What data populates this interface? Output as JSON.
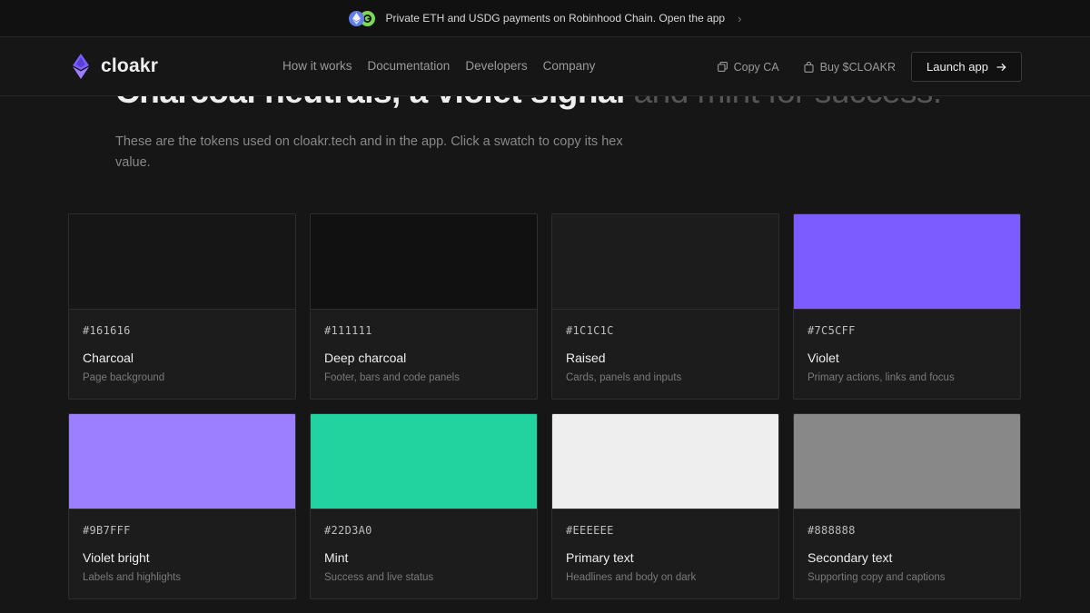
{
  "announcement": {
    "text": "Private ETH and USDG payments on Robinhood Chain. Open the app",
    "chevron": "›"
  },
  "header": {
    "logo_text": "cloakr",
    "nav": [
      "How it works",
      "Documentation",
      "Developers",
      "Company"
    ],
    "copy_ca": "Copy CA",
    "buy": "Buy $CLOAKR",
    "launch": "Launch app"
  },
  "hero": {
    "headline_strong": "Charcoal neutrals, a violet signal",
    "headline_muted": " and mint for success.",
    "subtitle": "These are the tokens used on cloakr.tech and in the app. Click a swatch to copy its hex value."
  },
  "swatches": [
    {
      "hex": "#161616",
      "name": "Charcoal",
      "desc": "Page background"
    },
    {
      "hex": "#111111",
      "name": "Deep charcoal",
      "desc": "Footer, bars and code panels"
    },
    {
      "hex": "#1C1C1C",
      "name": "Raised",
      "desc": "Cards, panels and inputs"
    },
    {
      "hex": "#7C5CFF",
      "name": "Violet",
      "desc": "Primary actions, links and focus"
    },
    {
      "hex": "#9B7FFF",
      "name": "Violet bright",
      "desc": "Labels and highlights"
    },
    {
      "hex": "#22D3A0",
      "name": "Mint",
      "desc": "Success and live status"
    },
    {
      "hex": "#EEEEEE",
      "name": "Primary text",
      "desc": "Headlines and body on dark"
    },
    {
      "hex": "#888888",
      "name": "Secondary text",
      "desc": "Supporting copy and captions"
    }
  ],
  "icons": {
    "eth": "ethereum-coin-icon",
    "usdg": "usdg-coin-icon",
    "copy": "copy-icon",
    "bag": "shopping-bag-icon",
    "arrow": "arrow-right-icon",
    "logo": "cloakr-logo-icon"
  },
  "colors": {
    "accent": "#7C5CFF",
    "background": "#161616",
    "bar": "#111111",
    "text": "#EEEEEE",
    "muted": "#888888"
  }
}
